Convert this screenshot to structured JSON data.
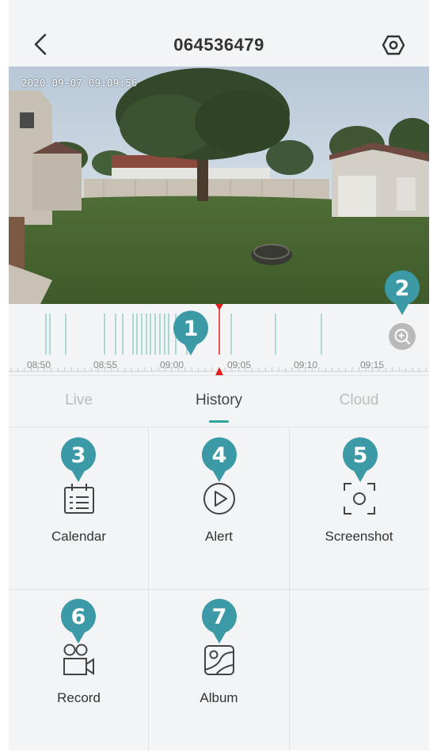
{
  "header": {
    "title": "064536479"
  },
  "camera": {
    "osd_timestamp": "2020 09-07 09:09:56"
  },
  "timeline": {
    "tick_labels": [
      "08:50",
      "08:55",
      "09:00",
      "09:05",
      "09:10",
      "09:15"
    ],
    "accent_color": "#2ea398",
    "playhead_color": "#e02020"
  },
  "tabs": [
    {
      "label": "Live",
      "active": false
    },
    {
      "label": "History",
      "active": true
    },
    {
      "label": "Cloud",
      "active": false
    }
  ],
  "features": [
    {
      "label": "Calendar",
      "icon": "calendar-icon",
      "callout": "3"
    },
    {
      "label": "Alert",
      "icon": "play-circle-icon",
      "callout": "4"
    },
    {
      "label": "Screenshot",
      "icon": "screenshot-icon",
      "callout": "5"
    },
    {
      "label": "Record",
      "icon": "video-camera-icon",
      "callout": "6"
    },
    {
      "label": "Album",
      "icon": "album-icon",
      "callout": "7"
    }
  ],
  "callouts": {
    "playhead": "1",
    "zoom": "2"
  },
  "colors": {
    "callout": "#3b9aa5",
    "background": "#f3f4f5"
  }
}
